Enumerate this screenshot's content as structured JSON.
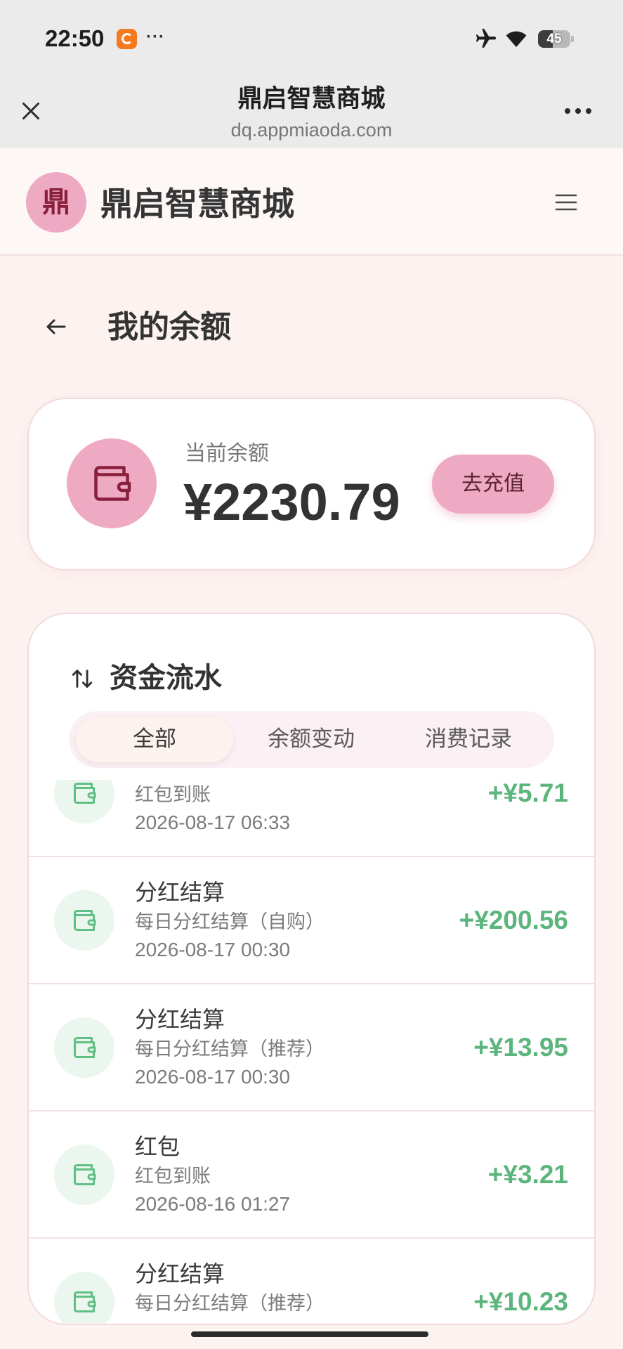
{
  "status_bar": {
    "time": "22:50",
    "more": "···",
    "battery": "45"
  },
  "browser": {
    "title": "鼎启智慧商城",
    "url": "dq.appmiaoda.com"
  },
  "app_header": {
    "logo_text": "鼎",
    "title": "鼎启智慧商城"
  },
  "page": {
    "title": "我的余额"
  },
  "balance": {
    "label": "当前余额",
    "amount": "¥2230.79",
    "recharge_label": "去充值"
  },
  "flow": {
    "title": "资金流水",
    "tabs": [
      {
        "label": "全部",
        "active": true
      },
      {
        "label": "余额变动",
        "active": false
      },
      {
        "label": "消费记录",
        "active": false
      }
    ],
    "items": [
      {
        "desc": "红包到账",
        "date": "2026-08-17 06:33",
        "amount": "+¥5.71"
      },
      {
        "title": "分红结算",
        "desc": "每日分红结算（自购）",
        "date": "2026-08-17 00:30",
        "amount": "+¥200.56"
      },
      {
        "title": "分红结算",
        "desc": "每日分红结算（推荐）",
        "date": "2026-08-17 00:30",
        "amount": "+¥13.95"
      },
      {
        "title": "红包",
        "desc": "红包到账",
        "date": "2026-08-16 01:27",
        "amount": "+¥3.21"
      },
      {
        "title": "分红结算",
        "desc": "每日分红结算（推荐）",
        "amount": "+¥10.23"
      }
    ]
  },
  "icons": {
    "close": "close-icon",
    "more": "more-dots-icon",
    "menu": "hamburger-menu-icon",
    "back": "arrow-left-icon",
    "wallet": "wallet-icon",
    "flow": "sort-arrows-icon",
    "airplane": "airplane-mode-icon",
    "wifi": "wifi-icon",
    "battery": "battery-icon"
  },
  "colors": {
    "brand_pink": "#eeaac2",
    "brand_dark": "#8a1f3d",
    "income_green": "#5bb57c",
    "page_bg": "#fcf2ef",
    "card_border": "#f3dadf",
    "status_bg": "#ebebeb"
  }
}
